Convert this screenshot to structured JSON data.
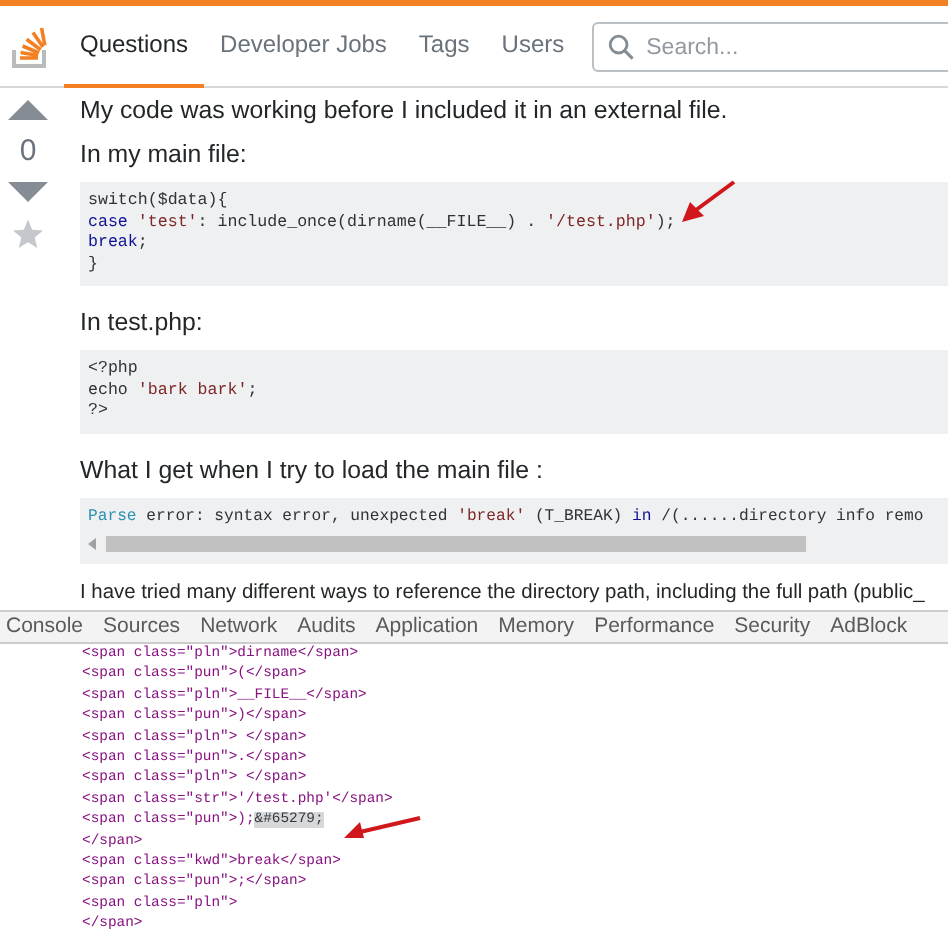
{
  "nav": {
    "tabs": [
      {
        "label": "Questions",
        "selected": true
      },
      {
        "label": "Developer Jobs",
        "selected": false
      },
      {
        "label": "Tags",
        "selected": false
      },
      {
        "label": "Users",
        "selected": false
      }
    ],
    "search": {
      "placeholder": "Search..."
    }
  },
  "votes": {
    "score": "0"
  },
  "post": [
    {
      "kind": "para",
      "text": "My code was working before I included it in an external file."
    },
    {
      "kind": "para",
      "text": "In my main file:"
    },
    {
      "kind": "code",
      "lines": [
        [
          {
            "t": "switch($data){",
            "color": "#303336"
          }
        ],
        [
          {
            "t": "case",
            "color": "#101094"
          },
          {
            "t": " 'test'",
            "color": "#7d2727"
          },
          {
            "t": ": include_once(dirname(__FILE__) . ",
            "color": "#303336"
          },
          {
            "t": "'/test.php'",
            "color": "#7d2727"
          },
          {
            "t": ");",
            "color": "#303336"
          }
        ],
        [
          {
            "t": "break",
            "color": "#101094"
          },
          {
            "t": ";",
            "color": "#303336"
          }
        ],
        [
          {
            "t": "}",
            "color": "#303336"
          }
        ]
      ]
    },
    {
      "kind": "para",
      "text": "In test.php:"
    },
    {
      "kind": "code",
      "lines": [
        [
          {
            "t": "<?php",
            "color": "#303336"
          }
        ],
        [
          {
            "t": "echo ",
            "color": "#303336"
          },
          {
            "t": "'bark bark'",
            "color": "#7d2727"
          },
          {
            "t": ";",
            "color": "#303336"
          }
        ],
        [
          {
            "t": "?>",
            "color": "#303336"
          }
        ]
      ]
    },
    {
      "kind": "para",
      "text": "What I get when I try to load the main file :"
    },
    {
      "kind": "error",
      "lines": [
        [
          {
            "t": "Parse",
            "color": "#2b91af"
          },
          {
            "t": " error: syntax error, unexpected ",
            "color": "#303336"
          },
          {
            "t": "'break'",
            "color": "#7d2727"
          },
          {
            "t": " (T_BREAK) ",
            "color": "#303336"
          },
          {
            "t": "in",
            "color": "#101094"
          },
          {
            "t": " /(......directory info remo",
            "color": "#303336"
          }
        ]
      ]
    },
    {
      "kind": "line",
      "text": "I have tried many different ways to reference the directory path, including the full path (public_"
    }
  ],
  "devtools": {
    "tabs": [
      "Console",
      "Sources",
      "Network",
      "Audits",
      "Application",
      "Memory",
      "Performance",
      "Security",
      "AdBlock"
    ],
    "lines": [
      {
        "text": "<span class=\"pln\">dirname</span>"
      },
      {
        "text": "<span class=\"pun\">(</span>"
      },
      {
        "text": "<span class=\"pln\">__FILE__</span>"
      },
      {
        "text": "<span class=\"pun\">)</span>"
      },
      {
        "text": "<span class=\"pln\"> </span>"
      },
      {
        "text": "<span class=\"pun\">.</span>"
      },
      {
        "text": "<span class=\"pln\"> </span>"
      },
      {
        "text": "<span class=\"str\">'/test.php'</span>"
      },
      {
        "text": "<span class=\"pun\">);",
        "highlight": "&#65279;"
      },
      {
        "text": "</span>"
      },
      {
        "text": "<span class=\"kwd\">break</span>"
      },
      {
        "text": "<span class=\"pun\">;</span>"
      },
      {
        "text": "<span class=\"pln\">"
      },
      {
        "text": "</span>"
      }
    ]
  }
}
